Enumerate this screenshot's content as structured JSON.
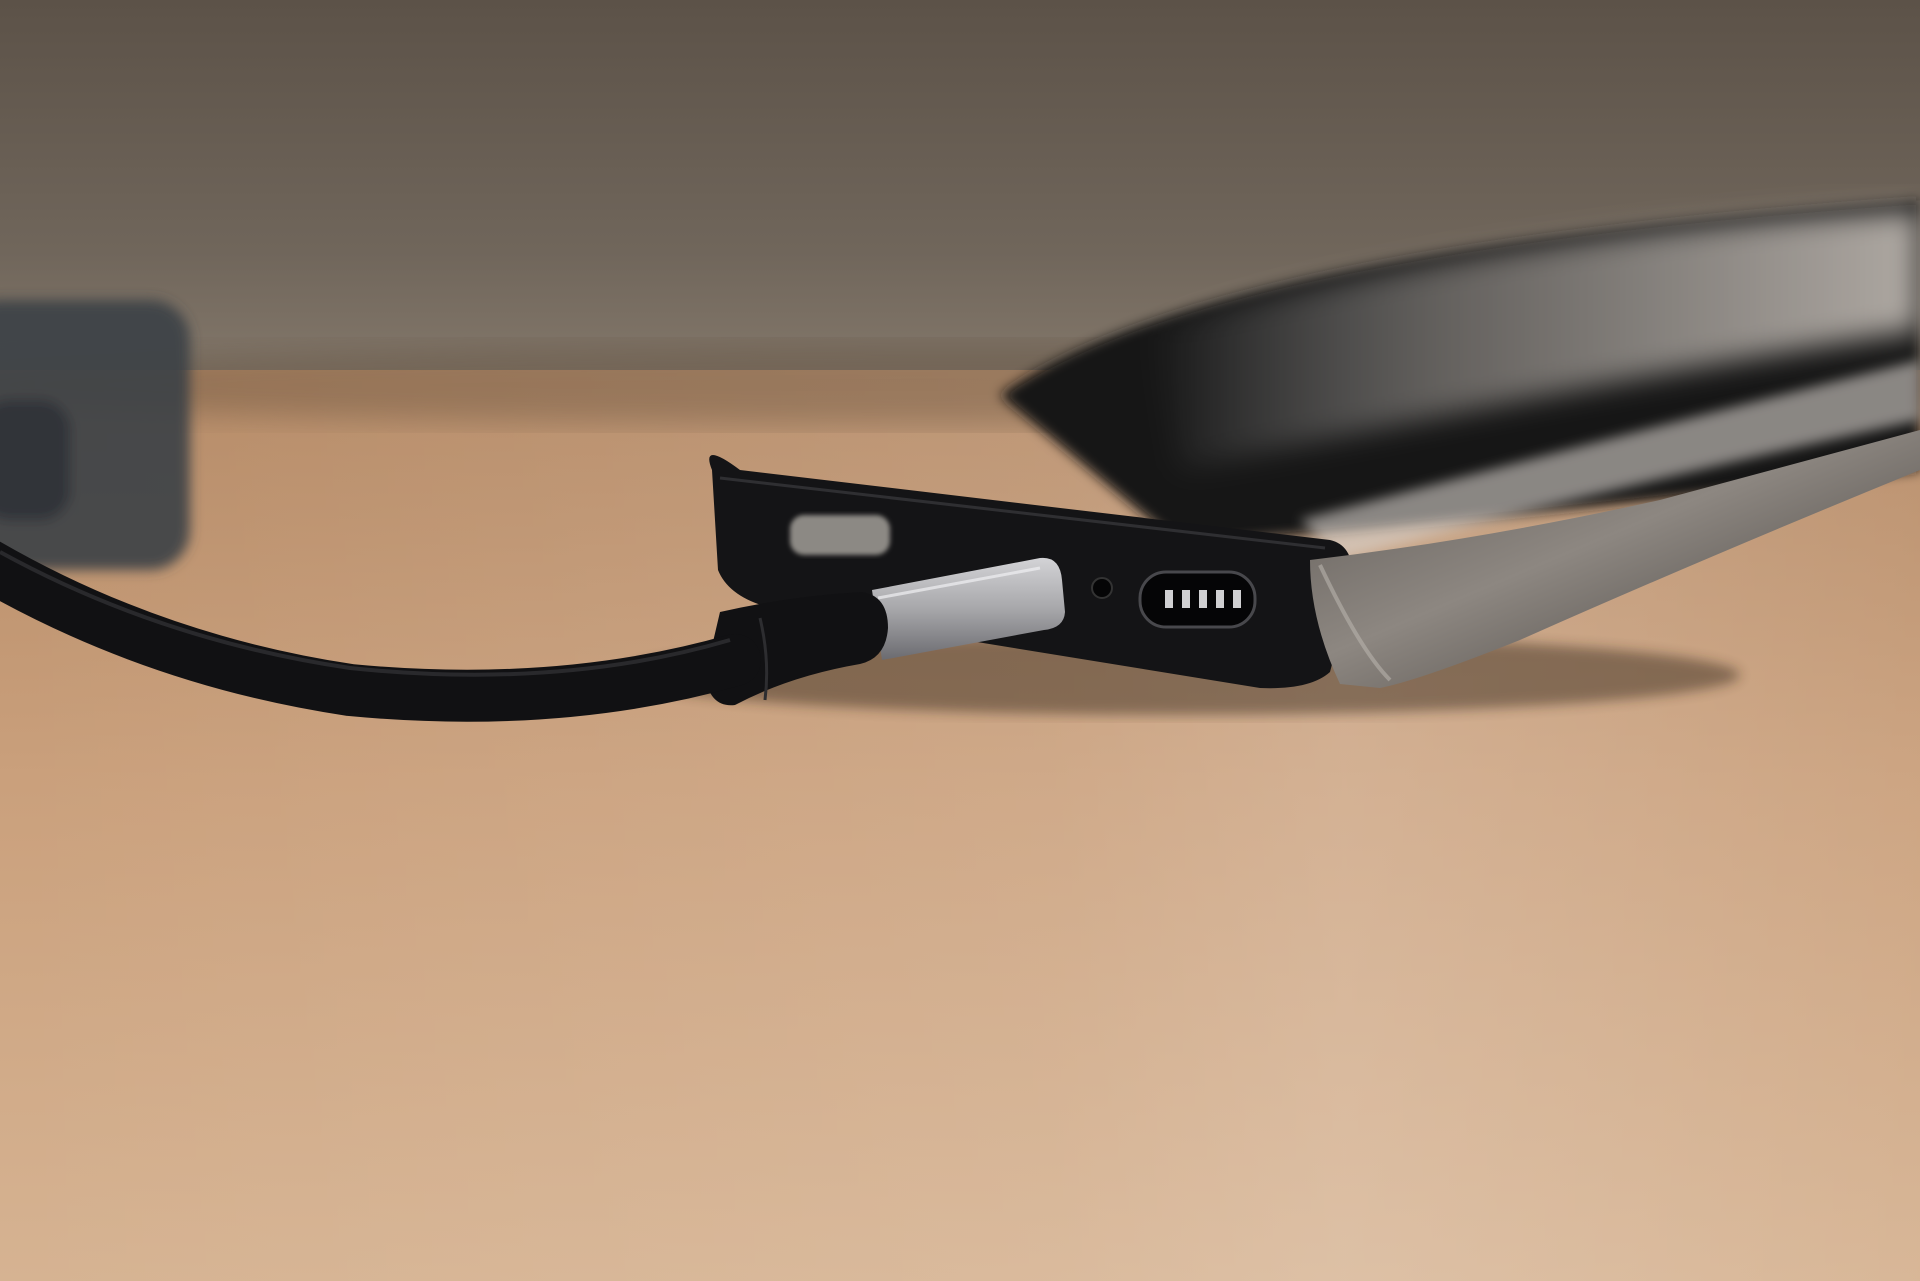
{
  "photo": {
    "subject": [
      "smartphone",
      "usb-c-cable",
      "wooden-desk"
    ],
    "colors": {
      "wall_top": "#5c5248",
      "wall_mid": "#70665b",
      "wall_bottom": "#8a7e70",
      "desk_far": "#b58a66",
      "desk_mid": "#caa07c",
      "desk_near": "#d6b392",
      "phone_body": "#141416",
      "phone_edge": "#2b2b2e",
      "phone_screen_glare": "#c9c2bb",
      "metal_corner": "#8d8781",
      "connector_metal": "#a7a7aa",
      "cable": "#111113",
      "left_object": "#3c4147"
    }
  }
}
